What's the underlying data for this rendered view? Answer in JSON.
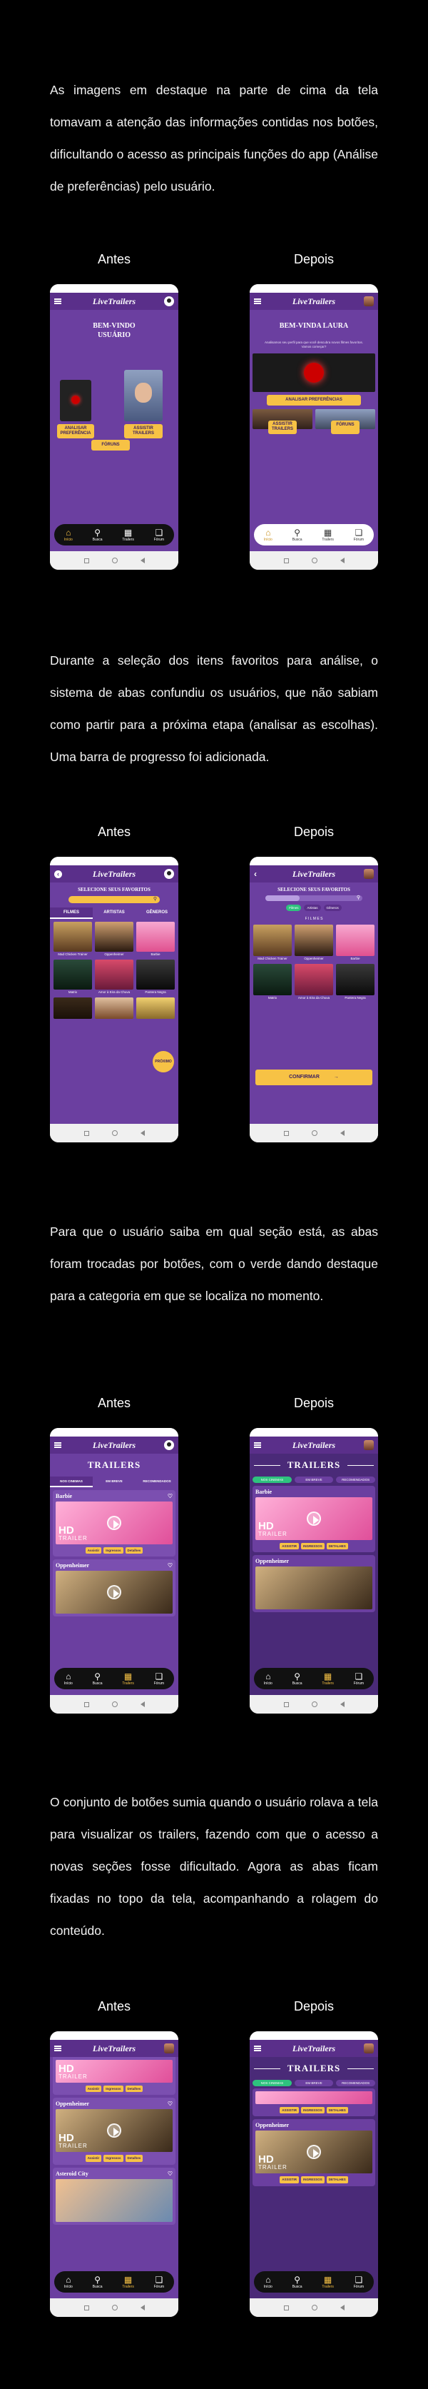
{
  "paragraphs": {
    "p1": "As imagens em destaque na parte de cima da tela tomavam a atenção das informações contidas nos botões, dificultando o acesso as principais funções do app (Análise de preferências) pelo usuário.",
    "p2": "Durante a seleção dos itens favoritos para análise, o sistema de abas confundiu os usuários, que não sabiam como partir para a próxima etapa (analisar as escolhas). Uma barra de progresso foi adicionada.",
    "p3": "Para que o usuário saiba em qual seção está, as abas foram trocadas por botões, com o verde dando destaque para a categoria em que se localiza no momento.",
    "p4": "O conjunto de botões sumia quando o usuário rolava a tela para visualizar os trailers, fazendo com que o acesso a novas seções fosse dificultado. Agora as abas ficam fixadas no topo da tela, acompanhando a rolagem do conteúdo."
  },
  "captions": {
    "before": "Antes",
    "after": "Depois"
  },
  "app": {
    "logo": "LiveTrailers"
  },
  "nav": {
    "home": "Início",
    "search": "Busca",
    "trailers": "Trailers",
    "forum": "Fórum"
  },
  "home_before": {
    "title": "BEM-VINDO USUÁRIO",
    "btn_analysis": "ANALISAR PREFERÊNCIA",
    "btn_trailers": "ASSISTIR TRAILERS",
    "btn_forum": "FÓRUNS"
  },
  "home_after": {
    "title": "BEM-VINDA LAURA",
    "subtitle": "Analisamos seu perfil para que você descubra novos filmes favoritos. Vamos começar?",
    "btn_analysis": "ANALISAR PREFERÊNCIAS",
    "btn_trailers": "ASSISTIR TRAILERS",
    "btn_forum": "FÓRUNS"
  },
  "select_before": {
    "title": "SELECIONE SEUS FAVORITOS",
    "tabs": [
      "FILMES",
      "ARTISTAS",
      "GÊNEROS"
    ],
    "posters": [
      "Mad Chicken Trainer",
      "Oppenheimer",
      "Barbie",
      "Matrix",
      "Amor à Eira da Chuva",
      "Pantera Negra",
      "",
      "",
      ""
    ],
    "next": "PRÓXIMO"
  },
  "select_after": {
    "title": "SELECIONE SEUS FAVORITOS",
    "tabs": [
      "Filmes",
      "Artistas",
      "Gêneros"
    ],
    "section": "F I L M E S",
    "posters": [
      "Mad Chicken Trainer",
      "Oppenheimer",
      "Barbie",
      "Matrix",
      "Amor à Eira da Chuva",
      "Pantera Negra"
    ],
    "confirm": "CONFIRMAR"
  },
  "trailers": {
    "title": "TRAILERS",
    "tabs_before": [
      "NOS CINEMAS",
      "EM BREVE",
      "RECOMENDADOS"
    ],
    "tabs_after": [
      "NOS CINEMAS",
      "EM BREVE",
      "RECOMENDADOS"
    ],
    "movies": [
      "Barbie",
      "Oppenheimer",
      "Asteroid City"
    ],
    "btns": [
      "Assistir",
      "Ingressos",
      "Detalhes"
    ],
    "btns_after": [
      "ASSISTIR",
      "INGRESSOS",
      "DETALHES"
    ],
    "hd": "HD",
    "trailer": "TRAILER"
  },
  "colors": {
    "purple": "#6b3fa0",
    "purple_dark": "#5a2f8a",
    "yellow": "#f7c245",
    "green": "#2ec27e"
  }
}
